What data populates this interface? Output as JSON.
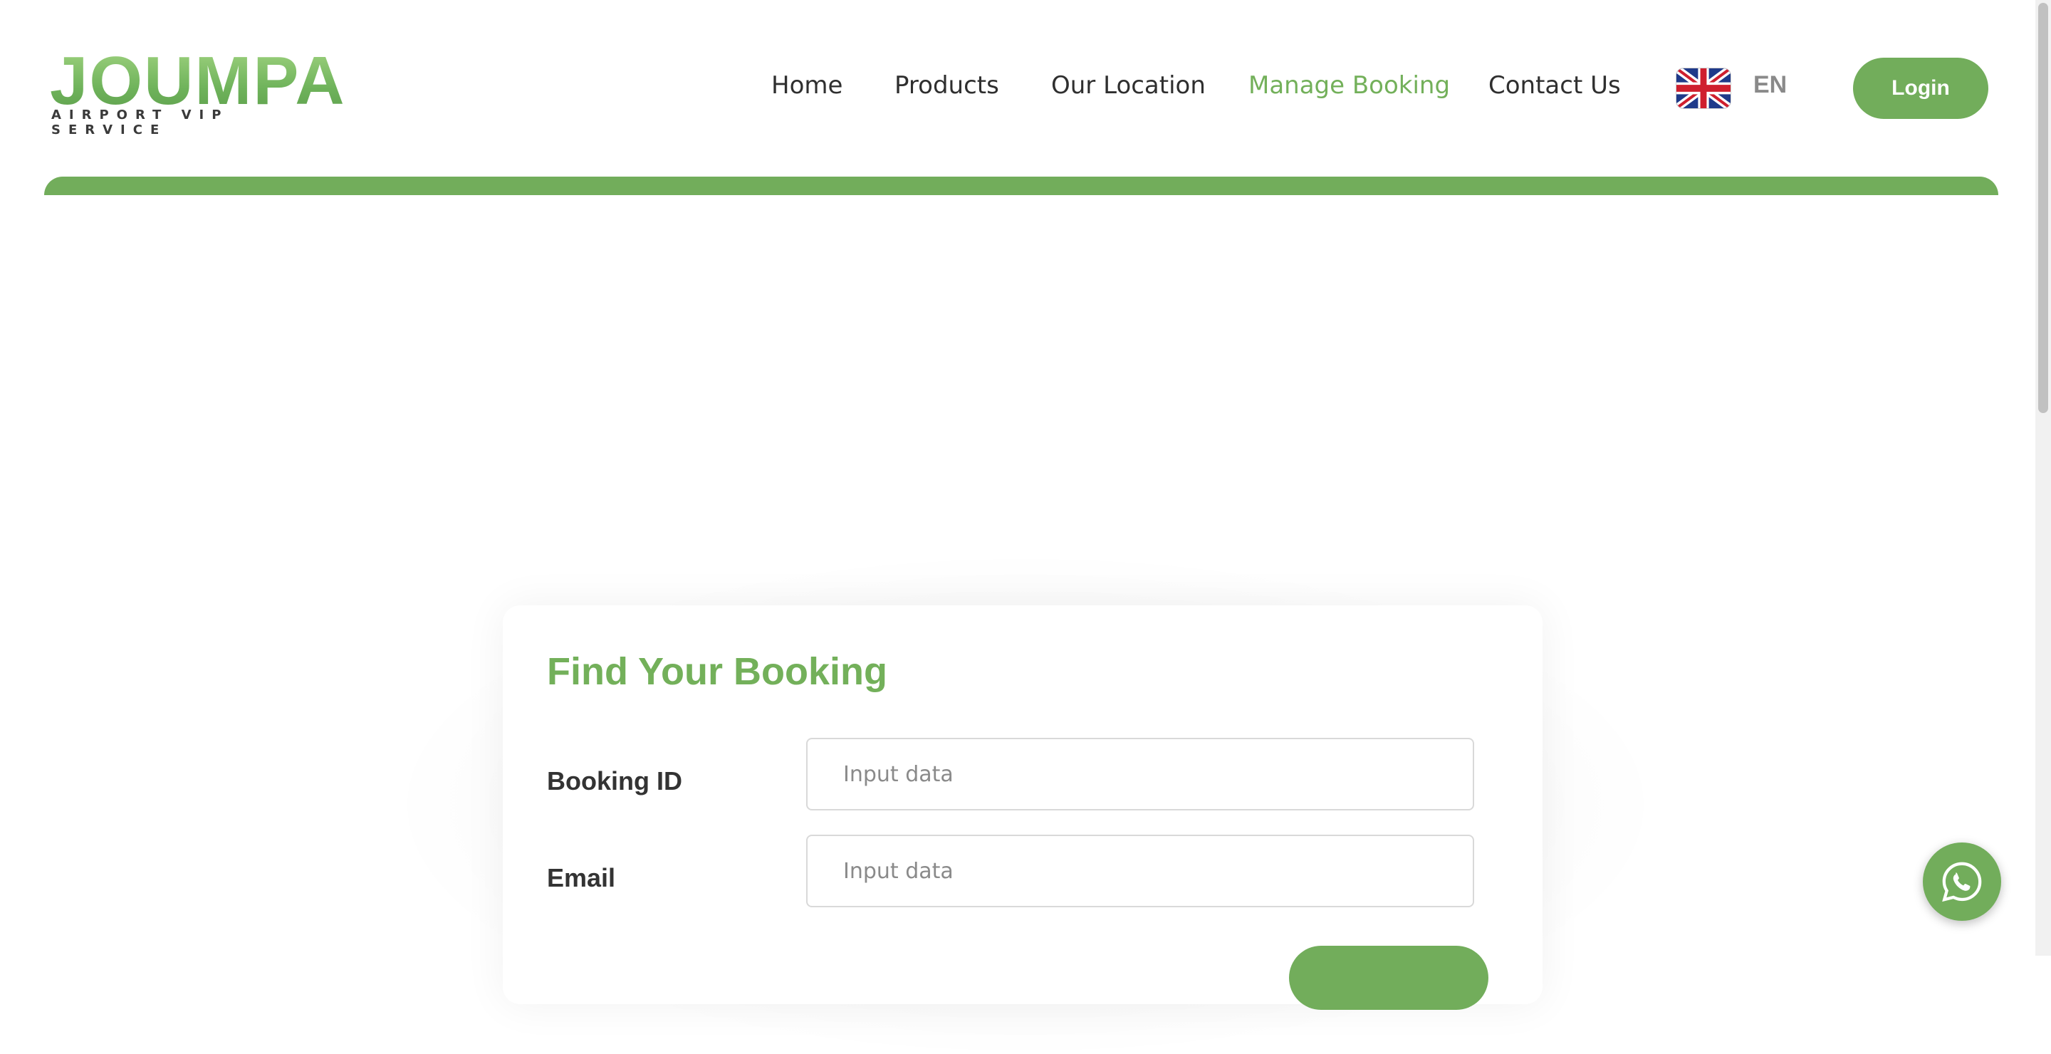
{
  "brand": {
    "logo_word": "JOUMPA",
    "logo_tagline": "AIRPORT VIP SERVICE",
    "accent_color": "#72ad5b"
  },
  "nav": {
    "items": [
      {
        "label": "Home"
      },
      {
        "label": "Products"
      },
      {
        "label": "Our Location"
      },
      {
        "label": "Manage Booking",
        "active": true
      },
      {
        "label": "Contact Us"
      }
    ],
    "language_flag_icon": "uk-flag-icon",
    "language_code": "EN",
    "login_label": "Login"
  },
  "booking_form": {
    "title": "Find Your Booking",
    "fields": [
      {
        "label": "Booking ID",
        "placeholder": "Input data",
        "value": ""
      },
      {
        "label": "Email",
        "placeholder": "Input data",
        "value": ""
      }
    ],
    "submit_icon": "submit-button"
  },
  "floating": {
    "whatsapp_icon": "whatsapp-icon"
  }
}
